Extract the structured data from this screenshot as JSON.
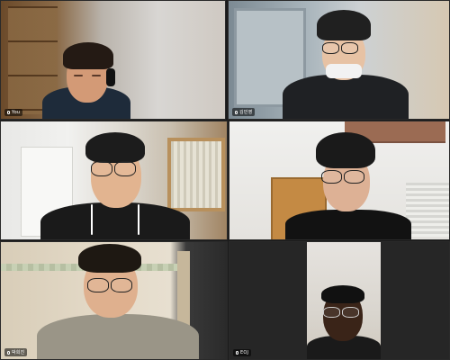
{
  "call": {
    "participants": [
      {
        "id": "p1",
        "name": "You"
      },
      {
        "id": "p2",
        "name": "김민영"
      },
      {
        "id": "p3",
        "name": ""
      },
      {
        "id": "p4",
        "name": ""
      },
      {
        "id": "p5",
        "name": "박희진"
      },
      {
        "id": "p6",
        "name": "EOJ"
      }
    ]
  }
}
